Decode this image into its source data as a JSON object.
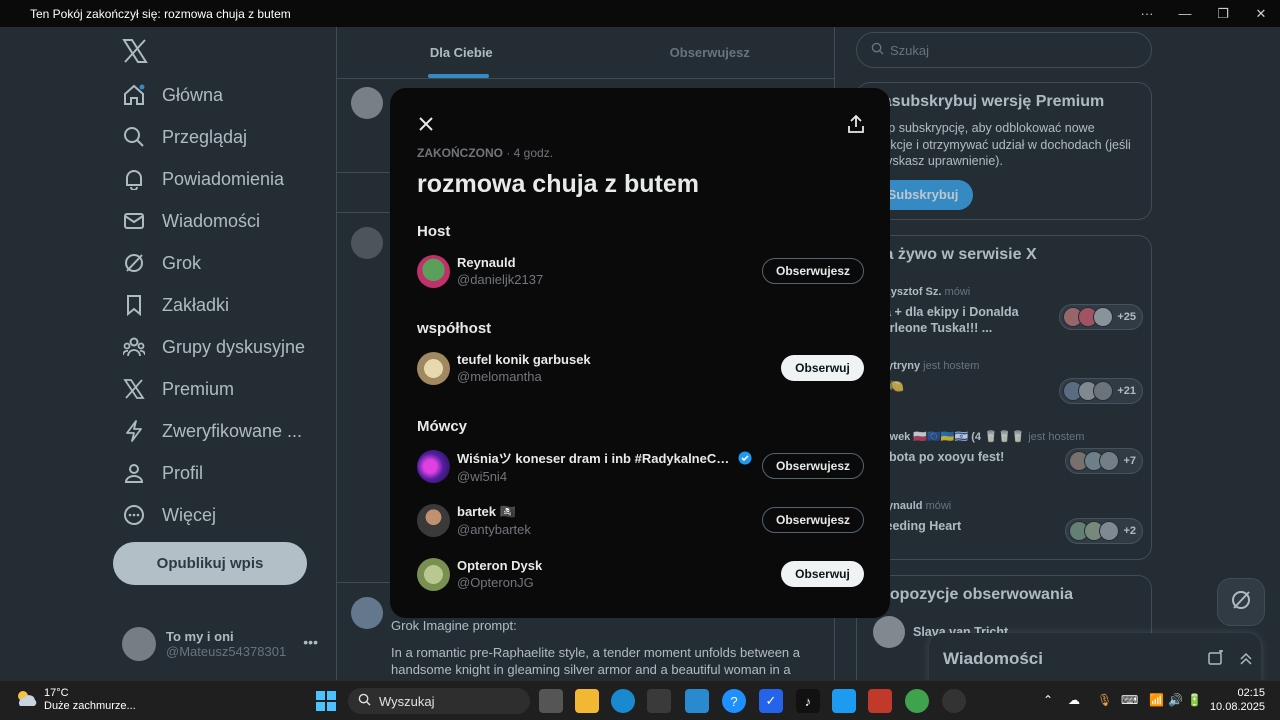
{
  "window": {
    "title": "Ten Pokój zakończył się: rozmowa chuja z butem",
    "controls": [
      "···",
      "—",
      "❐",
      "✕"
    ]
  },
  "nav": {
    "items": [
      {
        "label": "Główna",
        "icon": "home-icon"
      },
      {
        "label": "Przeglądaj",
        "icon": "search-icon"
      },
      {
        "label": "Powiadomienia",
        "icon": "bell-icon"
      },
      {
        "label": "Wiadomości",
        "icon": "envelope-icon"
      },
      {
        "label": "Grok",
        "icon": "grok-icon"
      },
      {
        "label": "Zakładki",
        "icon": "bookmark-icon"
      },
      {
        "label": "Grupy dyskusyjne",
        "icon": "people-icon"
      },
      {
        "label": "Premium",
        "icon": "x-icon"
      },
      {
        "label": "Zweryfikowane ...",
        "icon": "lightning-icon"
      },
      {
        "label": "Profil",
        "icon": "person-icon"
      },
      {
        "label": "Więcej",
        "icon": "more-icon"
      }
    ],
    "post_button": "Opublikuj wpis",
    "account": {
      "name": "To my i oni",
      "handle": "@Mateusz54378301"
    }
  },
  "feed": {
    "tabs": [
      "Dla Ciebie",
      "Obserwujesz"
    ],
    "grok_label": "Grok Imagine prompt:",
    "grok_text": "In a romantic pre-Raphaelite style, a tender moment unfolds between a handsome knight in gleaming silver armor and a beautiful woman in a"
  },
  "sidebar": {
    "search_placeholder": "Szukaj",
    "premium": {
      "title": "Zasubskrybuj wersję Premium",
      "text": "Kup subskrypcję, aby odblokować nowe funkcje i otrzymywać udział w dochodach (jeśli uzyskasz uprawnienie).",
      "button": "Subskrybuj"
    },
    "live": {
      "title": "Na żywo w serwisie X",
      "items": [
        {
          "who": "Krzysztof Sz.",
          "role": "mówi",
          "title": "dla + dla ekipy i Donalda Corleone Tuska!!! ...",
          "count": "+25"
        },
        {
          "who": "3Cytryny",
          "role": "jest hostem",
          "title": "🍋🍋",
          "count": "+21"
        },
        {
          "who": "Slawek 🇵🇱🇪🇺🇺🇦🇮🇱 (4 🥛🥛🥛",
          "role": "jest hostem",
          "title": "Sobota po xooyu fest!",
          "count": "+7"
        },
        {
          "who": "Reynauld",
          "role": "mówi",
          "title": "Bleeding Heart",
          "count": "+2"
        }
      ]
    },
    "follow": {
      "title": "Propozycje obserwowania",
      "user": "Slava van Tricht ..."
    },
    "dm_title": "Wiadomości"
  },
  "modal": {
    "status": "ZAKOŃCZONO",
    "time": "· 4 godz.",
    "title": "rozmowa chuja z butem",
    "sections": {
      "host": "Host",
      "cohost": "współhost",
      "speakers": "Mówcy"
    },
    "host": {
      "name": "Reynauld",
      "handle": "@danieljk2137",
      "button": "Obserwujesz"
    },
    "cohost": {
      "name": "teufel konik garbusek",
      "handle": "@melomantha",
      "button": "Obserwuj"
    },
    "speakers": [
      {
        "name": "Wiśniaツ koneser dram i inb #RadykalneCen...",
        "handle": "@wi5ni4",
        "button": "Obserwujesz",
        "verified": true
      },
      {
        "name": "bartek 🏴‍☠️",
        "handle": "@antybartek",
        "button": "Obserwujesz",
        "verified": false
      },
      {
        "name": "Opteron Dysk",
        "handle": "@OpteronJG",
        "button": "Obserwuj",
        "verified": false
      }
    ]
  },
  "taskbar": {
    "temp": "17°C",
    "weather": "Duże zachmurze...",
    "search": "Wyszukaj",
    "time": "02:15",
    "date": "10.08.2025"
  },
  "colors": {
    "accent": "#1d9bf0",
    "background": "#000000",
    "overlay": "rgba(91,112,131,0.4)"
  }
}
